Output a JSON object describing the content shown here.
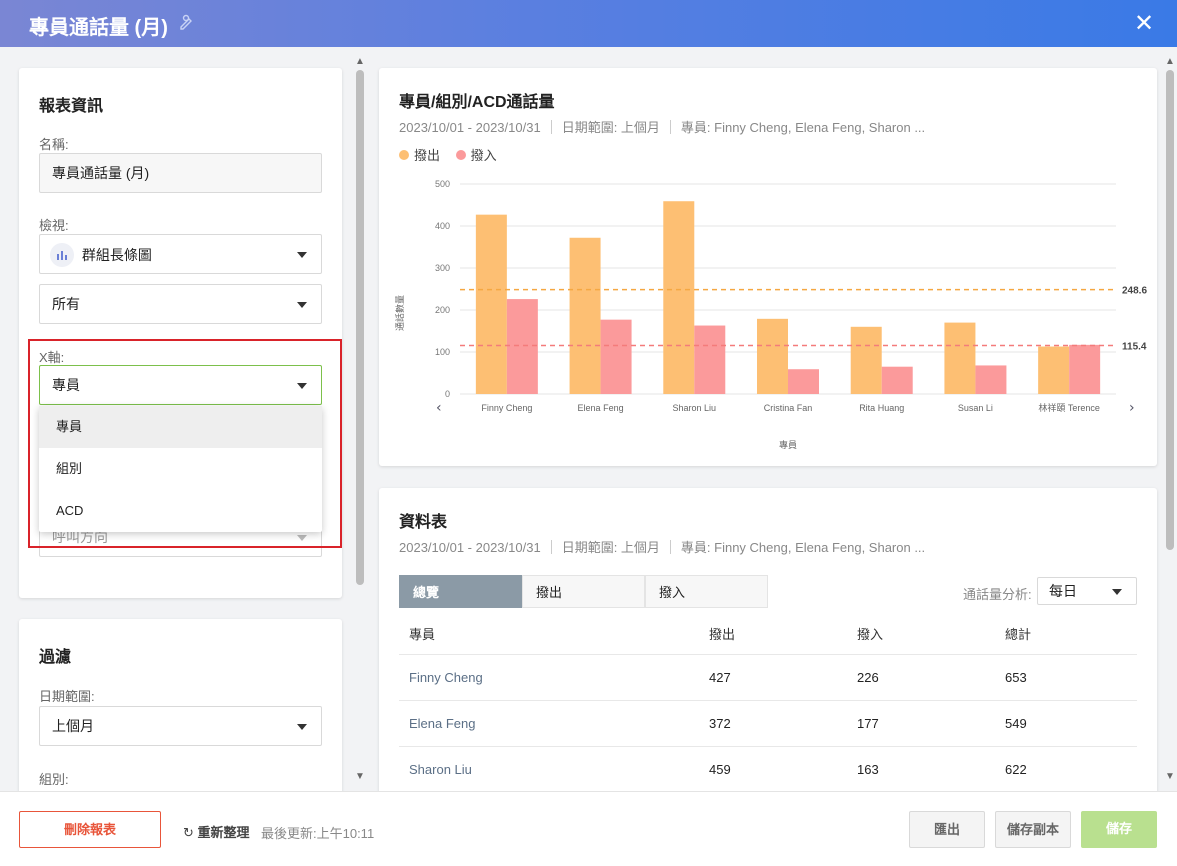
{
  "window": {
    "title": "專員通話量 (月)",
    "close_glyph": "✕"
  },
  "report_info": {
    "heading": "報表資訊",
    "name_label": "名稱:",
    "name_value": "專員通話量 (月)",
    "view_label": "檢視:",
    "view_value": "群組長條圖",
    "scope_value": "所有",
    "xaxis_label": "X軸:",
    "xaxis_value": "專員",
    "xaxis_options": [
      "專員",
      "組別",
      "ACD"
    ],
    "hidden_field_value": "呼叫方向"
  },
  "filter": {
    "heading": "過濾",
    "date_label": "日期範圍:",
    "date_value": "上個月",
    "group_label": "組別:"
  },
  "chart_card": {
    "title": "專員/組別/ACD通話量",
    "meta": [
      "2023/10/01 - 2023/10/31",
      "日期範圍: 上個月",
      "專員: Finny Cheng, Elena Feng, Sharon ..."
    ],
    "legend": [
      {
        "label": "撥出",
        "color": "#fdbf73"
      },
      {
        "label": "撥入",
        "color": "#fb9a9b"
      }
    ]
  },
  "chart_data": {
    "type": "bar",
    "categories": [
      "Finny Cheng",
      "Elena Feng",
      "Sharon Liu",
      "Cristina Fan",
      "Rita Huang",
      "Susan Li",
      "林祥頤 Terence"
    ],
    "series": [
      {
        "name": "撥出",
        "values": [
          427,
          372,
          459,
          179,
          160,
          170,
          113
        ],
        "color": "#fdbf73"
      },
      {
        "name": "撥入",
        "values": [
          226,
          177,
          163,
          59,
          65,
          68,
          117
        ],
        "color": "#fb9a9b"
      }
    ],
    "reference_lines": [
      {
        "value": 248.6,
        "label": "248.6",
        "color": "#f5a742"
      },
      {
        "value": 115.4,
        "label": "115.4",
        "color": "#f47b7b"
      }
    ],
    "ylim": [
      0,
      500
    ],
    "yticks": [
      0,
      100,
      200,
      300,
      400,
      500
    ],
    "xlabel": "專員",
    "ylabel": "通話數量",
    "grid": true
  },
  "table_card": {
    "title": "資料表",
    "meta": [
      "2023/10/01 - 2023/10/31",
      "日期範圍: 上個月",
      "專員: Finny Cheng, Elena Feng, Sharon ..."
    ],
    "tabs": [
      "總覽",
      "撥出",
      "撥入"
    ],
    "analysis_label": "通話量分析:",
    "analysis_value": "每日",
    "columns": [
      "專員",
      "撥出",
      "撥入",
      "總計"
    ],
    "rows": [
      [
        "Finny Cheng",
        "427",
        "226",
        "653"
      ],
      [
        "Elena Feng",
        "372",
        "177",
        "549"
      ],
      [
        "Sharon Liu",
        "459",
        "163",
        "622"
      ]
    ]
  },
  "footer": {
    "delete_label": "刪除報表",
    "refresh_label": "重新整理",
    "last_updated": "最後更新:上午10:11",
    "export_label": "匯出",
    "save_copy_label": "儲存副本",
    "save_label": "儲存"
  }
}
